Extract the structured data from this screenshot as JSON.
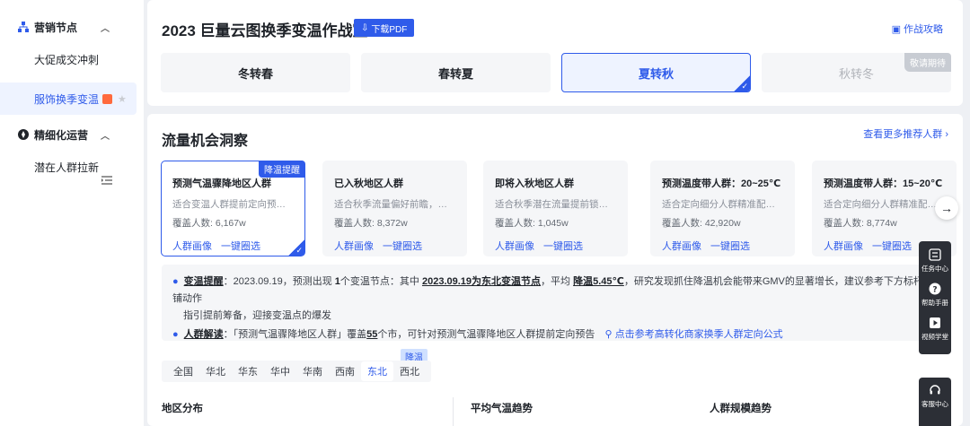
{
  "sidebar": {
    "groups": [
      {
        "label": "营销节点",
        "items": [
          "大促成交冲刺",
          "服饰换季变温"
        ]
      },
      {
        "label": "精细化运营",
        "items": [
          "潜在人群拉新"
        ]
      }
    ]
  },
  "header": {
    "title": "2023 巨量云图换季变温作战室",
    "pdf_button": "下载PDF",
    "guide_link": "作战攻略",
    "seasons": [
      "冬转春",
      "春转夏",
      "夏转秋",
      "秋转冬"
    ],
    "coming_soon": "敬请期待"
  },
  "insight": {
    "title": "流量机会洞察",
    "more_link": "查看更多推荐人群 ›",
    "hot_tag": "降温提醒",
    "cards": [
      {
        "title": "预测气温骤降地区人群",
        "desc": "适合变温人群提前定向预…",
        "cover": "覆盖人数: 6,167w"
      },
      {
        "title": "已入秋地区人群",
        "desc": "适合秋季流量偏好前瞻，…",
        "cover": "覆盖人数: 8,372w"
      },
      {
        "title": "即将入秋地区人群",
        "desc": "适合秋季潜在流量提前锁…",
        "cover": "覆盖人数: 1,045w"
      },
      {
        "title": "预测温度带人群：20~25℃",
        "desc": "适合定向细分人群精准配…",
        "cover": "覆盖人数: 42,920w"
      },
      {
        "title": "预测温度带人群：15~20℃",
        "desc": "适合定向细分人群精准配…",
        "cover": "覆盖人数: 8,774w"
      }
    ],
    "link_portrait": "人群画像",
    "link_select": "一键圈选",
    "notice": {
      "l1_label": "变温提醒",
      "l1_a": "：2023.09.19，预测出现 ",
      "l1_count": "1",
      "l1_b": "个变温节点：其中 ",
      "l1_node": "2023.09.19为东北变温节点",
      "l1_c": "，平均 ",
      "l1_drop": "降温5.45℃",
      "l1_d": "，研究发现抓住降温机会能带来GMV的显著增长，建议参考下方标杆店铺动作",
      "l1_e": "指引提前筹备，迎接变温点的爆发",
      "l2_label": "人群解读",
      "l2_a": "：「预测气温骤降地区人群」覆盖",
      "l2_num": "55",
      "l2_b": "个市，可针对预测气温骤降地区人群提前定向预告",
      "l2_link": "点击参考高转化商家换季人群定向公式"
    },
    "regions": [
      "全国",
      "华北",
      "华东",
      "华中",
      "华南",
      "西南",
      "东北",
      "西北"
    ],
    "region_tag": "降温",
    "sub_headers": [
      "地区分布",
      "平均气温趋势",
      "人群规模趋势"
    ]
  },
  "float_bar": {
    "items": [
      "任务中心",
      "帮助手册",
      "视频学堂"
    ],
    "service": "客服中心"
  }
}
